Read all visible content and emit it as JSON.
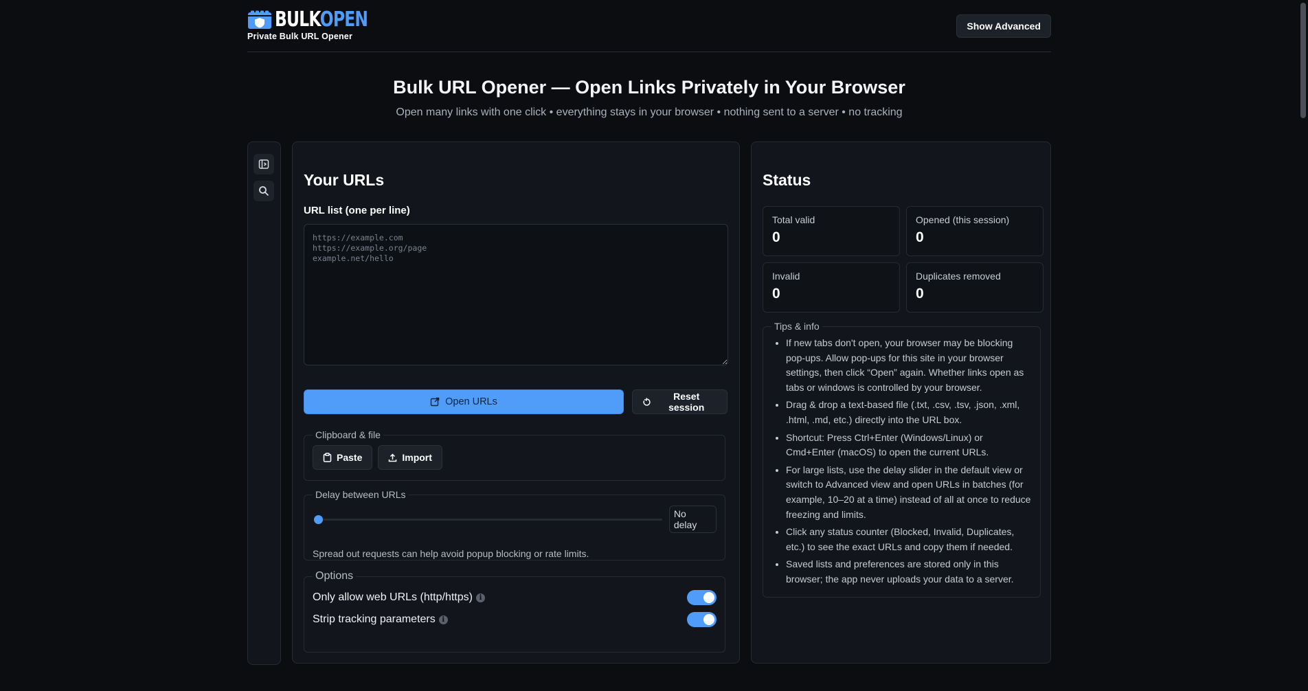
{
  "header": {
    "logo_bulk": "BULK",
    "logo_open": "OPEN",
    "logo_tagline": "Private Bulk URL Opener",
    "show_advanced_label": "Show Advanced"
  },
  "hero": {
    "title": "Bulk URL Opener — Open Links Privately in Your Browser",
    "subtitle": "Open many links with one click • everything stays in your browser • nothing sent to a server • no tracking"
  },
  "rail": {
    "icons": [
      "sidebar-toggle-icon",
      "search-icon"
    ]
  },
  "urls_panel": {
    "title": "Your URLs",
    "list_label": "URL list (one per line)",
    "placeholder": "https://example.com\nhttps://example.org/page\nexample.net/hello",
    "value": "",
    "open_label": "Open URLs",
    "reset_label": "Reset session",
    "clipboard_legend": "Clipboard & file",
    "paste_label": "Paste",
    "import_label": "Import",
    "delay_legend": "Delay between URLs",
    "delay_value": "No delay",
    "delay_level": 0,
    "delay_help": "Spread out requests can help avoid popup blocking or rate limits.",
    "options_legend": "Options",
    "options": [
      {
        "label": "Only allow web URLs (http/https)",
        "enabled": true
      },
      {
        "label": "Strip tracking parameters",
        "enabled": true
      }
    ]
  },
  "status_panel": {
    "title": "Status",
    "stats": [
      {
        "label": "Total valid",
        "value": "0"
      },
      {
        "label": "Opened (this session)",
        "value": "0"
      },
      {
        "label": "Invalid",
        "value": "0"
      },
      {
        "label": "Duplicates removed",
        "value": "0"
      }
    ],
    "tips_legend": "Tips & info",
    "tips": [
      "If new tabs don't open, your browser may be blocking pop-ups. Allow pop-ups for this site in your browser settings, then click “Open” again. Whether links open as tabs or windows is controlled by your browser.",
      "Drag & drop a text-based file (.txt, .csv, .tsv, .json, .xml, .html, .md, etc.) directly into the URL box.",
      "Shortcut: Press Ctrl+Enter (Windows/Linux) or Cmd+Enter (macOS) to open the current URLs.",
      "For large lists, use the delay slider in the default view or switch to Advanced view and open URLs in batches (for example, 10–20 at a time) instead of all at once to reduce freezing and limits.",
      "Click any status counter (Blocked, Invalid, Duplicates, etc.) to see the exact URLs and copy them if needed.",
      "Saved lists and preferences are stored only in this browser; the app never uploads your data to a server."
    ]
  },
  "colors": {
    "background": "#0b0d10",
    "panel": "#12151b",
    "accent": "#4f9cf9",
    "border": "#262b33"
  }
}
